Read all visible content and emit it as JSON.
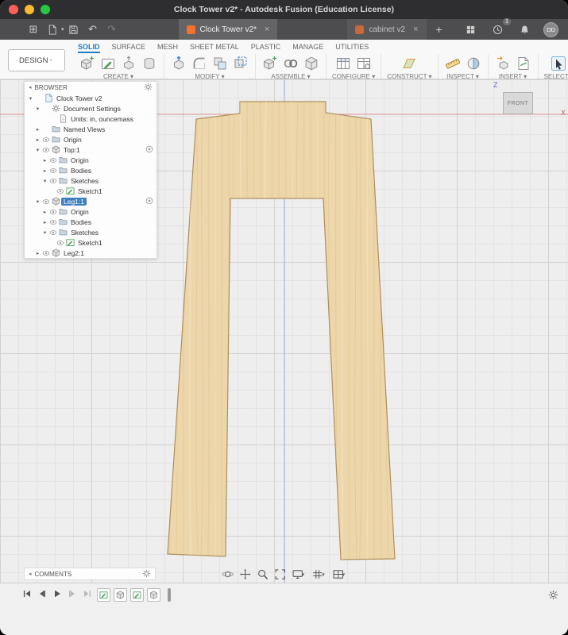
{
  "window": {
    "title": "Clock Tower v2* - Autodesk Fusion (Education License)"
  },
  "appbar": {
    "tabs": [
      {
        "label": "Clock Tower v2*",
        "active": true
      },
      {
        "label": "cabinet v2",
        "active": false
      }
    ],
    "new_tab_label": "+",
    "notification_count": "1",
    "avatar_initials": "DD"
  },
  "ribbon": {
    "design_label": "DESIGN",
    "tabs": [
      {
        "label": "SOLID",
        "active": true
      },
      {
        "label": "SURFACE",
        "active": false
      },
      {
        "label": "MESH",
        "active": false
      },
      {
        "label": "SHEET METAL",
        "active": false
      },
      {
        "label": "PLASTIC",
        "active": false
      },
      {
        "label": "MANAGE",
        "active": false
      },
      {
        "label": "UTILITIES",
        "active": false
      }
    ],
    "groups": [
      {
        "label": "CREATE",
        "icons": [
          "new-component",
          "create-sketch",
          "extrude",
          "revolve"
        ]
      },
      {
        "label": "MODIFY",
        "icons": [
          "press-pull",
          "fillet",
          "combine",
          "offset-face"
        ]
      },
      {
        "label": "ASSEMBLE",
        "icons": [
          "new-component",
          "joint",
          "rigid-group"
        ]
      },
      {
        "label": "CONFIGURE",
        "icons": [
          "configuration-table",
          "configure-features"
        ]
      },
      {
        "label": "CONSTRUCT",
        "icons": [
          "construction-plane"
        ]
      },
      {
        "label": "INSPECT",
        "icons": [
          "measure",
          "section-analysis"
        ]
      },
      {
        "label": "INSERT",
        "icons": [
          "insert-derive",
          "insert-svg"
        ]
      },
      {
        "label": "SELECT",
        "icons": [
          "select-cursor"
        ]
      }
    ]
  },
  "browser": {
    "header": "BROWSER",
    "items": [
      {
        "label": "Clock Tower v2",
        "indent": 0,
        "expand": "open",
        "icon": "document",
        "eye": false
      },
      {
        "label": "Document Settings",
        "indent": 1,
        "expand": "open",
        "icon": "gear",
        "eye": false
      },
      {
        "label": "Units: in, ouncemass",
        "indent": 2,
        "expand": "none",
        "icon": "units",
        "eye": false
      },
      {
        "label": "Named Views",
        "indent": 1,
        "expand": "closed",
        "icon": "folder",
        "eye": false
      },
      {
        "label": "Origin",
        "indent": 1,
        "expand": "closed",
        "icon": "folder",
        "eye": true
      },
      {
        "label": "Top:1",
        "indent": 1,
        "expand": "open",
        "icon": "component",
        "eye": true,
        "radio": true
      },
      {
        "label": "Origin",
        "indent": 2,
        "expand": "closed",
        "icon": "folder",
        "eye": true
      },
      {
        "label": "Bodies",
        "indent": 2,
        "expand": "closed",
        "icon": "folder",
        "eye": true
      },
      {
        "label": "Sketches",
        "indent": 2,
        "expand": "open",
        "icon": "folder",
        "eye": true
      },
      {
        "label": "Sketch1",
        "indent": 3,
        "expand": "none",
        "icon": "sketch",
        "eye": true
      },
      {
        "label": "Leg1:1",
        "indent": 1,
        "expand": "open",
        "icon": "component",
        "eye": true,
        "selected": true,
        "radio": true
      },
      {
        "label": "Origin",
        "indent": 2,
        "expand": "closed",
        "icon": "folder",
        "eye": true
      },
      {
        "label": "Bodies",
        "indent": 2,
        "expand": "closed",
        "icon": "folder",
        "eye": true
      },
      {
        "label": "Sketches",
        "indent": 2,
        "expand": "open",
        "icon": "folder",
        "eye": true
      },
      {
        "label": "Sketch1",
        "indent": 3,
        "expand": "none",
        "icon": "sketch",
        "eye": true
      },
      {
        "label": "Leg2:1",
        "indent": 1,
        "expand": "closed",
        "icon": "component",
        "eye": true
      }
    ]
  },
  "canvas": {
    "viewcube_face": "FRONT",
    "axis_z_label": "Z",
    "axis_x_label": "X"
  },
  "comments": {
    "header": "COMMENTS"
  },
  "navbar": {
    "icons": [
      {
        "name": "orbit",
        "dropdown": false
      },
      {
        "name": "pan",
        "dropdown": false
      },
      {
        "name": "zoom",
        "dropdown": false
      },
      {
        "name": "fit",
        "dropdown": false
      },
      {
        "name": "display-settings",
        "dropdown": true
      },
      {
        "name": "grid-and-snaps",
        "dropdown": true
      },
      {
        "name": "viewports",
        "dropdown": true
      }
    ]
  },
  "timeline": {
    "playback": [
      "skip-start",
      "step-back",
      "play",
      "step-forward",
      "skip-end"
    ],
    "features": [
      "sketch",
      "extrude",
      "sketch",
      "extrude"
    ]
  },
  "colors": {
    "accent_blue": "#1a7fc4",
    "selection_blue": "#3f7fc1",
    "fusion_orange": "#f6712b",
    "wood_fill": "#ecd6aa",
    "wood_grain": "#c6a06a",
    "wood_outline": "#b08f5c",
    "axis_x_red": "#e39090",
    "axis_z_blue": "#9aa6e4",
    "traffic_close": "#ff5f57",
    "traffic_min": "#febc2e",
    "traffic_max": "#28c840"
  }
}
